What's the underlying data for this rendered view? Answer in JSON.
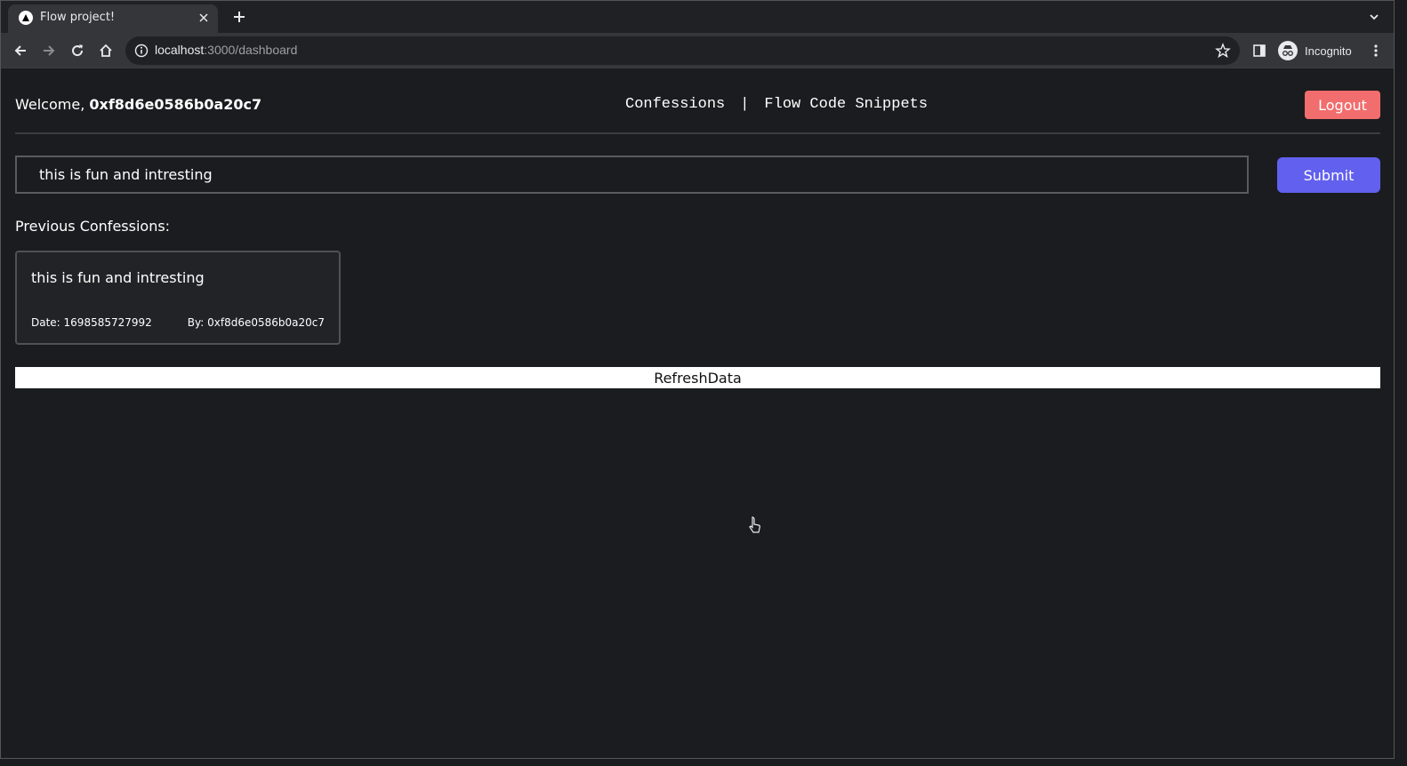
{
  "browser": {
    "tab_title": "Flow project!",
    "url_host": "localhost",
    "url_path": ":3000/dashboard",
    "profile_label": "Incognito"
  },
  "header": {
    "welcome_prefix": "Welcome,",
    "address": "0xf8d6e0586b0a20c7",
    "nav": [
      {
        "label": "Confessions"
      },
      {
        "label": "Flow Code Snippets"
      }
    ],
    "nav_separator": "|",
    "logout_label": "Logout"
  },
  "form": {
    "input_value": "this is fun and intresting",
    "submit_label": "Submit"
  },
  "previous": {
    "heading": "Previous Confessions:",
    "items": [
      {
        "text": "this is fun and intresting",
        "date": "Date: 1698585727992",
        "by": "By: 0xf8d6e0586b0a20c7"
      }
    ]
  },
  "refresh_label": "RefreshData",
  "colors": {
    "background": "#1b1c1f",
    "logout": "#f26d6d",
    "submit": "#6260ee"
  }
}
